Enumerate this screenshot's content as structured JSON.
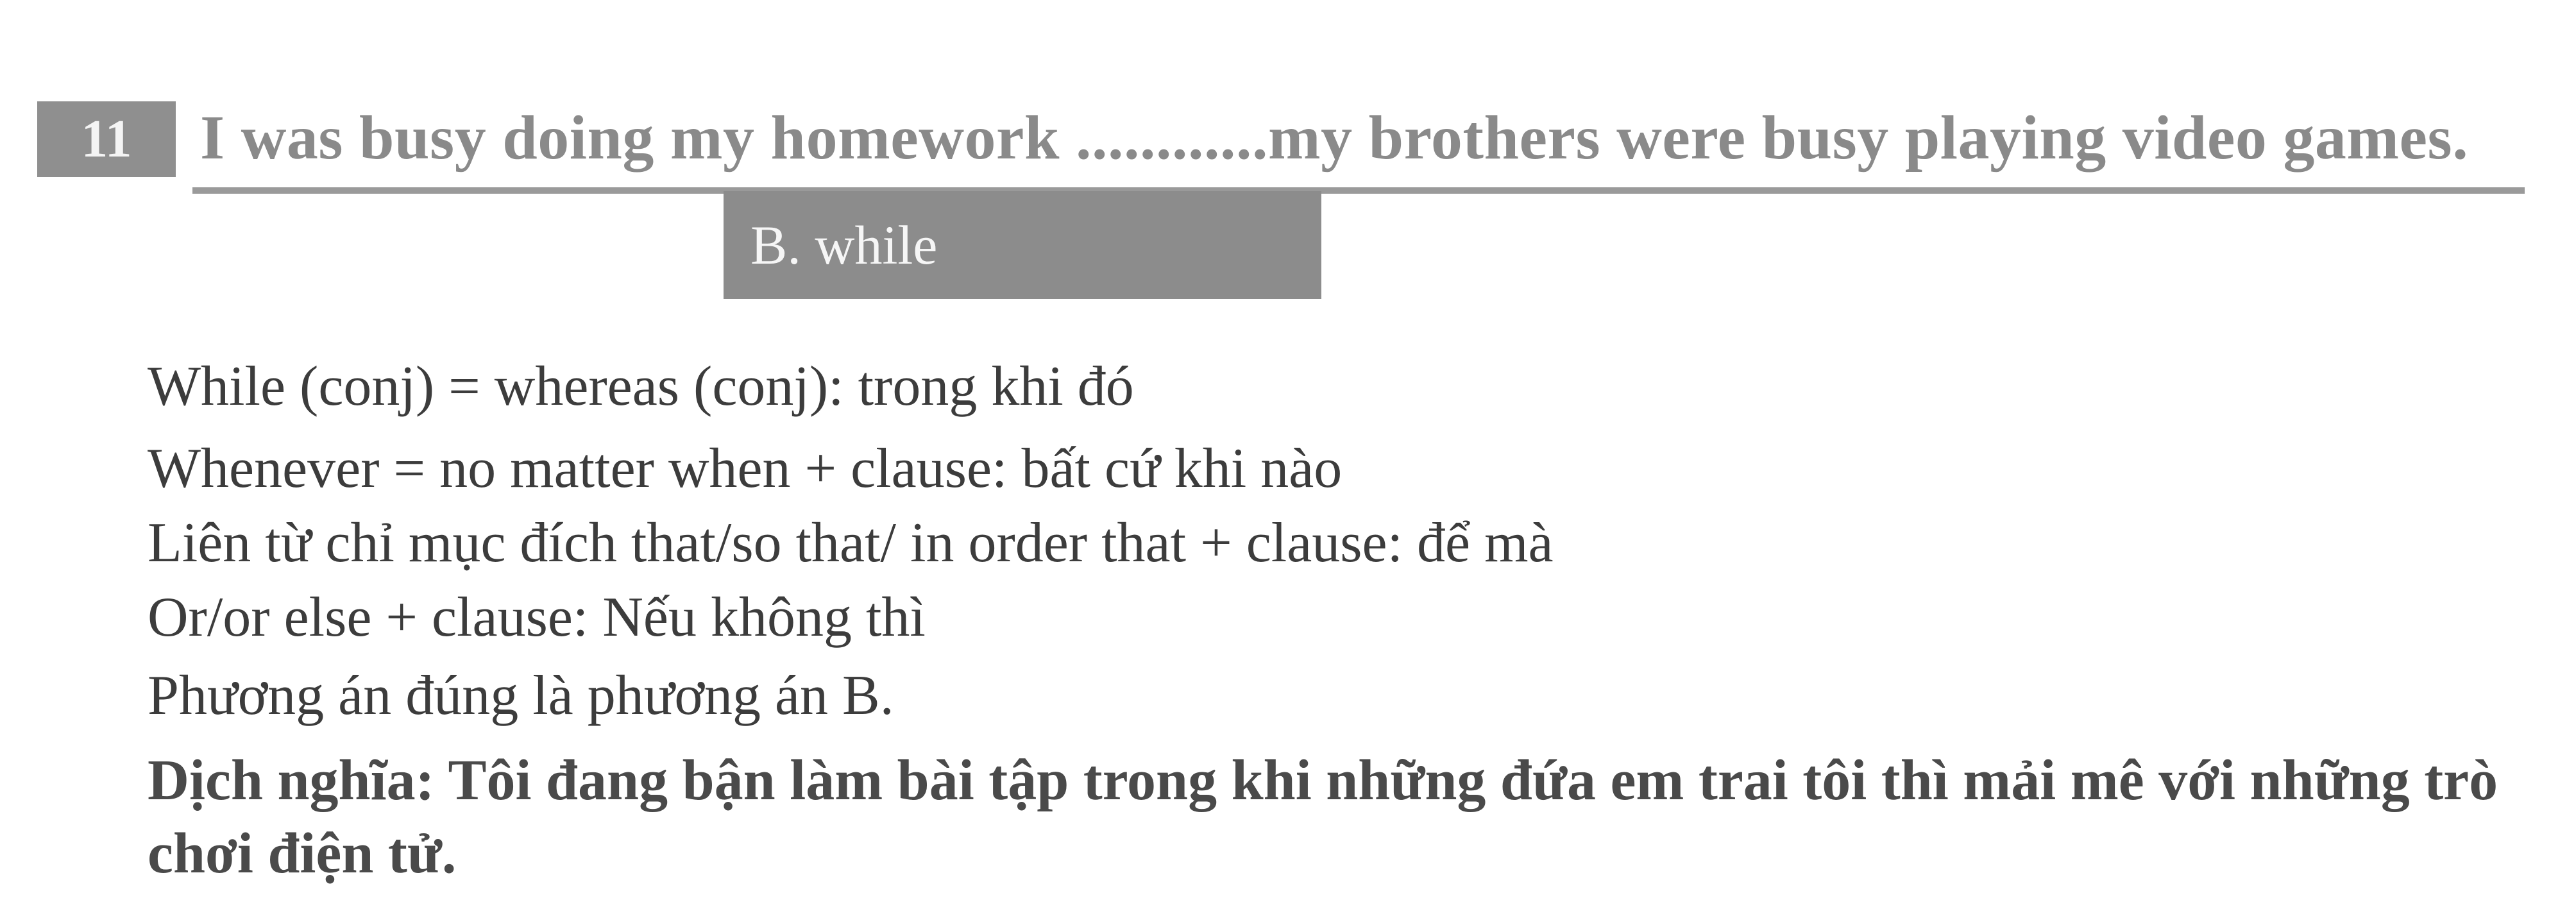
{
  "question": {
    "number": "11",
    "text": "I was busy doing my homework ............my brothers were busy playing video games."
  },
  "answer": {
    "label": "B. while"
  },
  "explanation": {
    "lines": [
      "While (conj) = whereas (conj): trong khi đó",
      "Whenever = no matter when + clause: bất cứ khi nào",
      "Liên từ chỉ mục đích that/so that/ in order that + clause: để  mà",
      "Or/or else + clause: Nếu không thì",
      "Phương án đúng là phương án B."
    ]
  },
  "translation": {
    "text": "Dịch nghĩa: Tôi đang bận làm bài tập trong khi những đứa em trai tôi thì mải mê với những trò chơi điện tử."
  }
}
